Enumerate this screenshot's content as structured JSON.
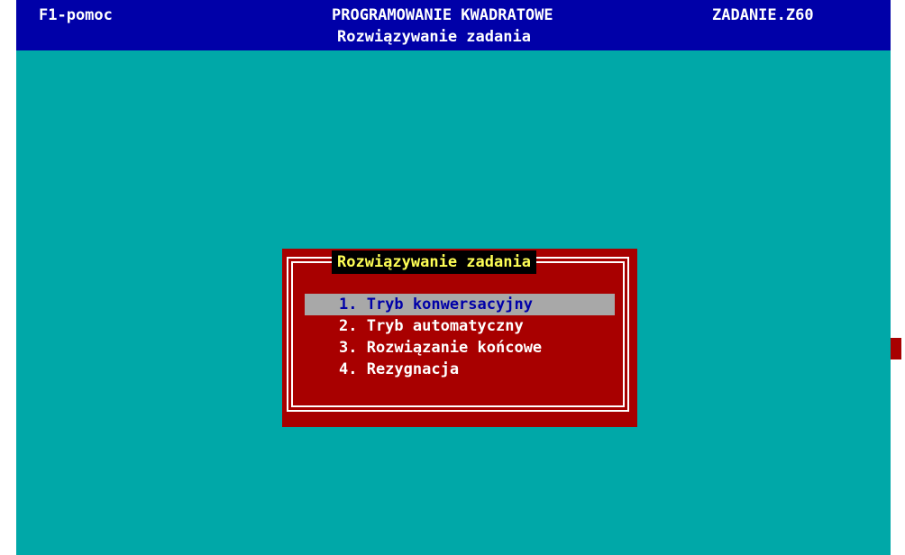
{
  "header": {
    "help": "F1-pomoc",
    "title": "PROGRAMOWANIE KWADRATOWE",
    "file": "ZADANIE.Z60",
    "subtitle": "Rozwiązywanie zadania"
  },
  "dialog": {
    "title": "Rozwiązywanie zadania",
    "items": [
      {
        "label": "1. Tryb konwersacyjny",
        "selected": true
      },
      {
        "label": "2. Tryb automatyczny",
        "selected": false
      },
      {
        "label": "3. Rozwiązanie końcowe",
        "selected": false
      },
      {
        "label": "4. Rezygnacja",
        "selected": false
      }
    ]
  },
  "colors": {
    "background": "#00a8a8",
    "header": "#0000a8",
    "dialog": "#a80000",
    "highlight": "#a8a8a8",
    "title_text": "#ffff55"
  }
}
